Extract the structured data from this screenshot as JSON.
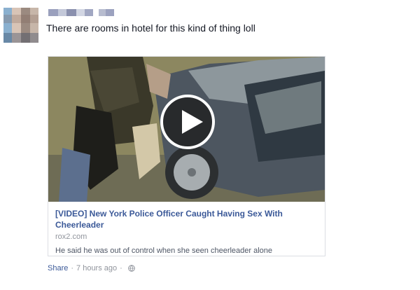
{
  "post": {
    "text": "There are rooms in hotel for this kind of thing loll"
  },
  "link_card": {
    "title": "[VIDEO] New York Police Officer Caught Having Sex With Cheerleader",
    "domain": "rox2.com",
    "description": "He said he was out of control when she seen cheerleader alone"
  },
  "footer": {
    "share_label": "Share",
    "separator": "·",
    "time": "7 hours ago",
    "privacy_icon": "globe-icon"
  },
  "colors": {
    "link_blue": "#3b5998",
    "meta_gray": "#90949c",
    "text_dark": "#141823"
  }
}
